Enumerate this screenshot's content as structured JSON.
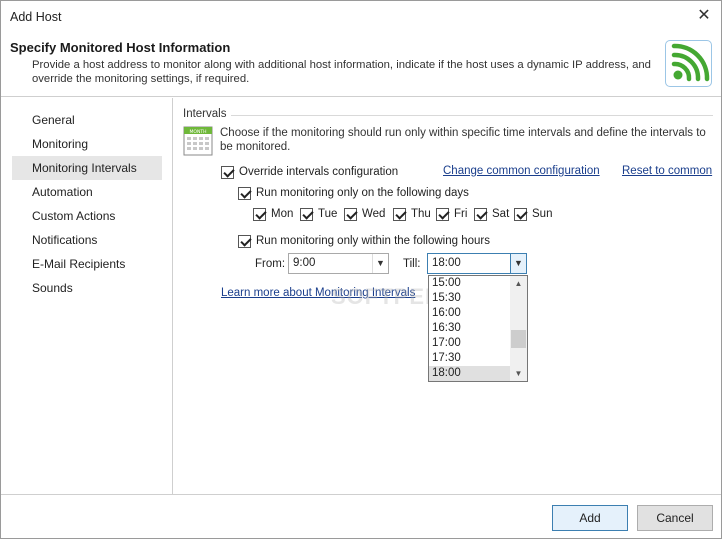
{
  "window": {
    "title": "Add Host",
    "close_glyph": "✕"
  },
  "header": {
    "title": "Specify Monitored Host Information",
    "description": "Provide a host address to monitor along with additional host information, indicate if the host uses a dynamic IP address, and override the monitoring settings, if required.",
    "logo_icon": "wifi-signal-icon",
    "accent": "#44a832"
  },
  "sidebar": {
    "items": [
      {
        "label": "General"
      },
      {
        "label": "Monitoring"
      },
      {
        "label": "Monitoring Intervals",
        "active": true
      },
      {
        "label": "Automation"
      },
      {
        "label": "Custom Actions"
      },
      {
        "label": "Notifications"
      },
      {
        "label": "E-Mail Recipients"
      },
      {
        "label": "Sounds"
      }
    ]
  },
  "intervals": {
    "group_label": "Intervals",
    "calendar_icon_text": "MONTH",
    "intro": "Choose if the monitoring should run only within specific time intervals and define the intervals to be monitored.",
    "override_label": "Override intervals configuration",
    "change_common_link": "Change common configuration",
    "reset_link": "Reset to common",
    "days_label": "Run monitoring only on the following days",
    "days": [
      {
        "label": "Mon",
        "checked": true
      },
      {
        "label": "Tue",
        "checked": true
      },
      {
        "label": "Wed",
        "checked": true
      },
      {
        "label": "Thu",
        "checked": true
      },
      {
        "label": "Fri",
        "checked": true
      },
      {
        "label": "Sat",
        "checked": true
      },
      {
        "label": "Sun",
        "checked": true
      }
    ],
    "hours_label": "Run monitoring only within the following hours",
    "from_label": "From:",
    "from_value": "9:00",
    "till_label": "Till:",
    "till_value": "18:00",
    "till_options": [
      "15:00",
      "15:30",
      "16:00",
      "16:30",
      "17:00",
      "17:30",
      "18:00"
    ],
    "till_selected": "18:00",
    "learn_more_link": "Learn more about Monitoring Intervals"
  },
  "watermark": "SOFTPEDIA",
  "footer": {
    "add_label": "Add",
    "cancel_label": "Cancel"
  }
}
